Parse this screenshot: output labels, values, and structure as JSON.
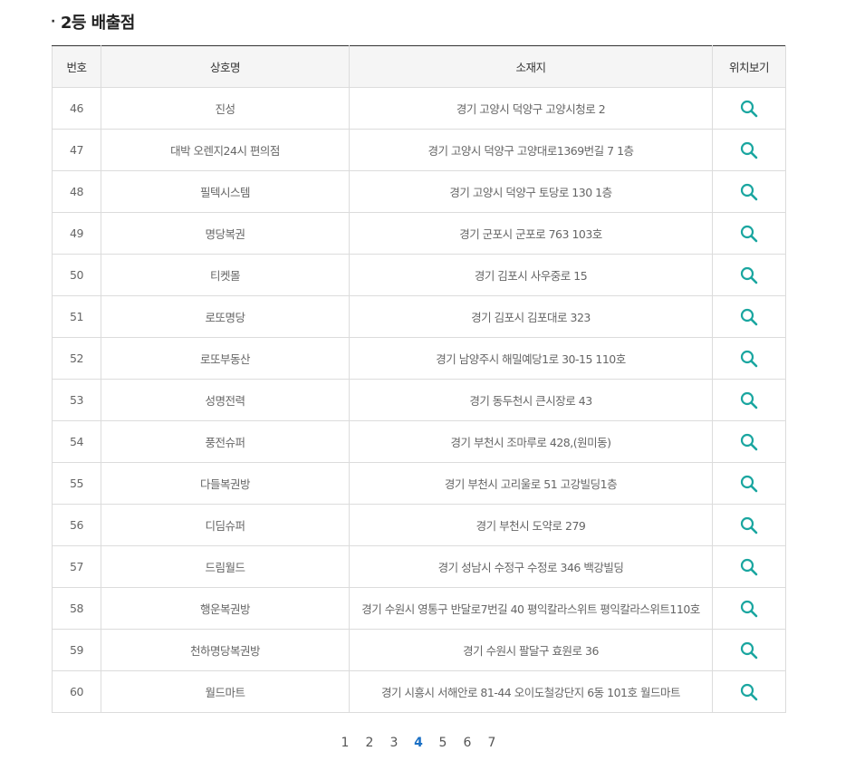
{
  "section": {
    "bullet": "·",
    "title": "2등 배출점"
  },
  "table": {
    "headers": {
      "no": "번호",
      "name": "상호명",
      "address": "소재지",
      "location": "위치보기"
    },
    "rows": [
      {
        "no": "46",
        "name": "진성",
        "address": "경기 고양시 덕양구 고양시청로 2"
      },
      {
        "no": "47",
        "name": "대박 오렌지24시 편의점",
        "address": "경기 고양시 덕양구 고양대로1369번길 7 1층"
      },
      {
        "no": "48",
        "name": "필텍시스템",
        "address": "경기 고양시 덕양구 토당로 130 1층"
      },
      {
        "no": "49",
        "name": "명당복권",
        "address": "경기 군포시 군포로 763 103호"
      },
      {
        "no": "50",
        "name": "티켓몰",
        "address": "경기 김포시 사우중로 15"
      },
      {
        "no": "51",
        "name": "로또명당",
        "address": "경기 김포시 김포대로 323"
      },
      {
        "no": "52",
        "name": "로또부동산",
        "address": "경기 남양주시 해밀예당1로 30-15 110호"
      },
      {
        "no": "53",
        "name": "성명전력",
        "address": "경기 동두천시 큰시장로 43"
      },
      {
        "no": "54",
        "name": "풍전슈퍼",
        "address": "경기 부천시 조마루로 428,(원미동)"
      },
      {
        "no": "55",
        "name": "다들복권방",
        "address": "경기 부천시 고리울로 51 고강빌딩1층"
      },
      {
        "no": "56",
        "name": "디딤슈퍼",
        "address": "경기 부천시 도약로 279"
      },
      {
        "no": "57",
        "name": "드림월드",
        "address": "경기 성남시 수정구 수정로 346 백강빌딩"
      },
      {
        "no": "58",
        "name": "행운복권방",
        "address": "경기 수원시 영통구 반달로7번길 40 평익칼라스위트 평익칼라스위트110호"
      },
      {
        "no": "59",
        "name": "천하명당복권방",
        "address": "경기 수원시 팔달구 효원로 36"
      },
      {
        "no": "60",
        "name": "월드마트",
        "address": "경기 시흥시 서해안로 81-44 오이도철강단지 6동 101호 월드마트"
      }
    ],
    "location_icon": "search-icon",
    "icon_color": "#1aa6a0"
  },
  "pagination": {
    "pages": [
      "1",
      "2",
      "3",
      "4",
      "5",
      "6",
      "7"
    ],
    "current": "4",
    "current_color": "#1a6fc4"
  }
}
